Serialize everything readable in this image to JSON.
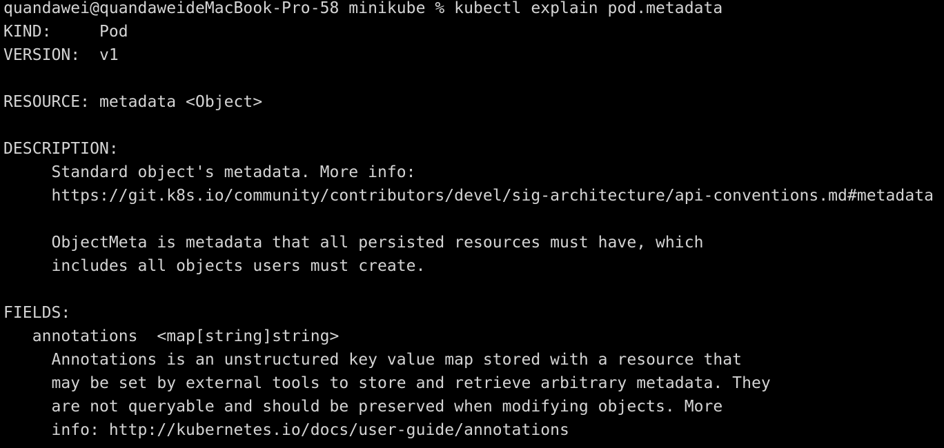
{
  "terminal": {
    "lines": [
      "quandawei@quandaweideMacBook-Pro-58 minikube % kubectl explain pod.metadata",
      "KIND:     Pod",
      "VERSION:  v1",
      "",
      "RESOURCE: metadata <Object>",
      "",
      "DESCRIPTION:",
      "     Standard object's metadata. More info:",
      "     https://git.k8s.io/community/contributors/devel/sig-architecture/api-conventions.md#metadata",
      "",
      "     ObjectMeta is metadata that all persisted resources must have, which",
      "     includes all objects users must create.",
      "",
      "FIELDS:",
      "   annotations  <map[string]string>",
      "     Annotations is an unstructured key value map stored with a resource that",
      "     may be set by external tools to store and retrieve arbitrary metadata. They",
      "     are not queryable and should be preserved when modifying objects. More",
      "     info: http://kubernetes.io/docs/user-guide/annotations"
    ]
  },
  "colors": {
    "background": "#000000",
    "foreground": "#d4d4d4"
  }
}
